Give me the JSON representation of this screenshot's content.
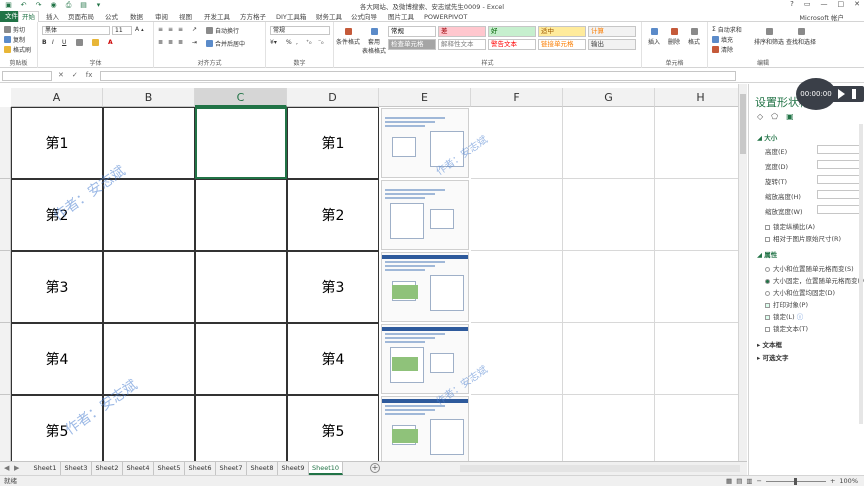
{
  "window": {
    "title": "各大网站、及微博搜索、安志斌先生0009 - Excel",
    "controls": [
      "?",
      "▭",
      "—",
      "□",
      "✕"
    ]
  },
  "tabs": {
    "file": "文件",
    "items": [
      "开始",
      "插入",
      "页面布局",
      "公式",
      "数据",
      "审阅",
      "视图",
      "开发工具",
      "方方格子",
      "DIY工具箱",
      "财务工具",
      "公式向导",
      "图片工具",
      "POWERPIVOT"
    ],
    "active": "开始",
    "account": "Microsoft 帐户"
  },
  "ribbon": {
    "clipboard": {
      "cut": "剪切",
      "copy": "复制",
      "format_painter": "格式刷",
      "label": "剪贴板"
    },
    "font": {
      "name": "黑体",
      "size": "11",
      "bold": "B",
      "italic": "I",
      "underline": "U",
      "label": "字体"
    },
    "alignment": {
      "wrap": "自动换行",
      "merge": "合并后居中",
      "label": "对齐方式"
    },
    "number": {
      "format": "常规",
      "percent": "%",
      "comma": ",",
      "label": "数字"
    },
    "styles": {
      "conditional": "条件格式",
      "table": "套用\n表格格式",
      "cells": [
        {
          "text": "常规",
          "bg": "#ffffff",
          "color": "#000000"
        },
        {
          "text": "差",
          "bg": "#ffc7ce",
          "color": "#9c0006"
        },
        {
          "text": "好",
          "bg": "#c6efce",
          "color": "#006100"
        },
        {
          "text": "适中",
          "bg": "#ffeb9c",
          "color": "#9c5700"
        },
        {
          "text": "计算",
          "bg": "#f2f2f2",
          "color": "#fa7d00"
        },
        {
          "text": "检查单元格",
          "bg": "#a5a5a5",
          "color": "#ffffff"
        },
        {
          "text": "解释性文本",
          "bg": "#ffffff",
          "color": "#7f7f7f"
        },
        {
          "text": "警告文本",
          "bg": "#ffffff",
          "color": "#ff0000"
        },
        {
          "text": "链接单元格",
          "bg": "#ffffff",
          "color": "#fa7d00"
        },
        {
          "text": "输出",
          "bg": "#f2f2f2",
          "color": "#3f3f3f"
        }
      ],
      "label": "样式"
    },
    "cells": {
      "insert": "插入",
      "delete": "删除",
      "format": "格式",
      "label": "单元格"
    },
    "editing": {
      "autosum": "自动求和",
      "fill": "填充",
      "clear": "清除",
      "sort": "排序和筛选",
      "find": "查找和选择",
      "label": "编辑"
    }
  },
  "formula_bar": {
    "name_box": "",
    "cancel": "✕",
    "enter": "✓",
    "fx": "fx",
    "content": ""
  },
  "grid": {
    "columns": [
      "A",
      "B",
      "C",
      "D",
      "E",
      "F",
      "G",
      "H"
    ],
    "selected_column": "C",
    "col_a": [
      "第1",
      "第2",
      "第3",
      "第4",
      "第5"
    ],
    "col_d": [
      "第1",
      "第2",
      "第3",
      "第4",
      "第5"
    ],
    "watermarks": [
      "作者：安志斌",
      "作者：安志斌",
      "作者：安志斌",
      "作者：安志斌"
    ]
  },
  "sheets": {
    "tabs": [
      "Sheet1",
      "Sheet3",
      "Sheet2",
      "Sheet4",
      "Sheet5",
      "Sheet6",
      "Sheet7",
      "Sheet8",
      "Sheet9",
      "Sheet10"
    ],
    "active": "Sheet10",
    "add": "+"
  },
  "status": {
    "ready": "就绪",
    "zoom": "100%"
  },
  "pane": {
    "title": "设置形状格式",
    "size_section": "大小",
    "rows": [
      "高度(E)",
      "宽度(D)",
      "旋转(T)",
      "缩放高度(H)",
      "缩放宽度(W)"
    ],
    "lock_aspect": "锁定纵横比(A)",
    "relative_original": "相对于图片原始尺寸(R)",
    "props_section": "属性",
    "props": [
      "大小和位置随单元格而变(S)",
      "大小固定，位置随单元格而变(M)",
      "大小和位置均固定(D)"
    ],
    "print_obj": "打印对象(P)",
    "locked": "锁定(L)",
    "lock_text": "锁定文本(T)",
    "textbox": "文本框",
    "alt_text": "可选文字"
  },
  "video": {
    "time": "00:00:00"
  }
}
